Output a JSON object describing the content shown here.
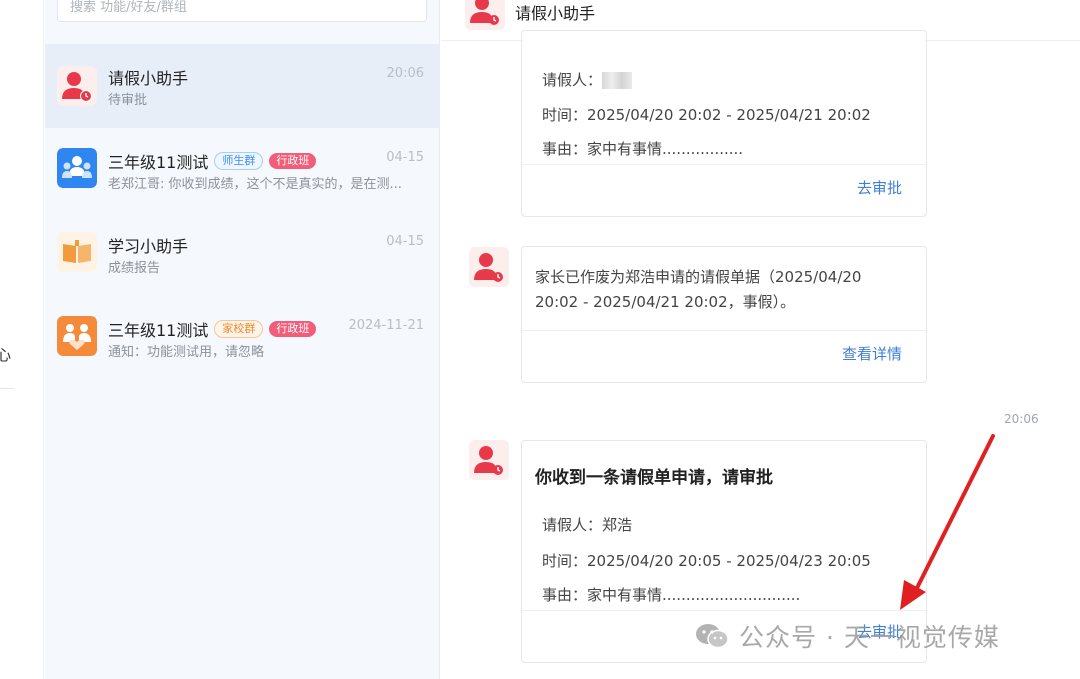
{
  "colors": {
    "accent_blue": "#3f7fd6",
    "tag_red": "#f25e7a",
    "active_bg": "#e7eef8",
    "arrow_red": "#e02020"
  },
  "left_strip": {
    "fragment": "心"
  },
  "search": {
    "placeholder": "搜索 功能/好友/群组"
  },
  "conversations": [
    {
      "name": "请假小助手",
      "time": "20:06",
      "preview": "待审批",
      "icon": "leave-assistant-icon",
      "tags": []
    },
    {
      "name": "三年级11测试",
      "time": "04-15",
      "preview": "老郑江哥: 你收到成绩，这个不是真实的，是在测...",
      "icon": "group-people-icon",
      "tags": [
        "师生群",
        "行政班"
      ]
    },
    {
      "name": "学习小助手",
      "time": "04-15",
      "preview": "成绩报告",
      "icon": "open-book-icon",
      "tags": []
    },
    {
      "name": "三年级11测试",
      "time": "2024-11-21",
      "preview": "通知：功能测试用，请忽略",
      "icon": "family-heart-icon",
      "tags": [
        "家校群",
        "行政班"
      ]
    }
  ],
  "chat": {
    "title": "请假小助手",
    "message1": {
      "applicant": "请假人：",
      "time": "时间：2025/04/20 20:02 - 2025/04/21 20:02",
      "reason": "事由：家中有事情.................",
      "action": "去审批"
    },
    "message2": {
      "text": "家长已作废为郑浩申请的请假单据（2025/04/20 20:02 - 2025/04/21 20:02，事假）。",
      "action": "查看详情"
    },
    "timestamp": "20:06",
    "message3": {
      "title": "你收到一条请假单申请，请审批",
      "applicant": "请假人：郑浩",
      "time": "时间：2025/04/20 20:05 - 2025/04/23 20:05",
      "reason": "事由：家中有事情.............................",
      "action": "去审批"
    }
  },
  "watermark": {
    "text": "公众号 · 天一视觉传媒",
    "icon": "wechat-icon"
  }
}
